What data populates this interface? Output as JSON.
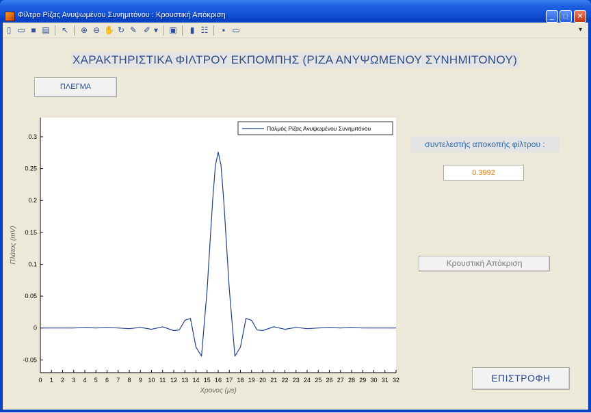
{
  "window": {
    "title": "Φίλτρο Ρίζας Ανυψωμένου Συνημιτόνου : Κρουστική Απόκριση"
  },
  "toolbar": {
    "icons": [
      "new-file-icon",
      "open-folder-icon",
      "save-icon",
      "print-icon",
      "pointer-icon",
      "zoom-in-icon",
      "zoom-out-icon",
      "pan-icon",
      "rotate-3d-icon",
      "data-cursor-icon",
      "brush-icon",
      "dropdown-arrow-icon",
      "link-plot-icon",
      "colorbar-icon",
      "legend-icon",
      "hide-plot-tools-icon",
      "show-plot-tools-icon"
    ]
  },
  "header": {
    "title": "ΧΑΡΑΚΤΗΡΙΣΤΙΚΑ ΦΙΛΤΡΟΥ ΕΚΠΟΜΠΗΣ (ΡΙΖΑ ΑΝΥΨΩΜΕΝΟΥ ΣΥΝΗΜΙΤΟΝΟΥ)"
  },
  "controls": {
    "grid_label": "ΠΛΕΓΜΑ",
    "coef_label": "συντελεστής αποκοπής φίλτρου :",
    "coef_value": "0.3992",
    "impulse_label": "Κρουστική Απόκριση",
    "back_label": "ΕΠΙΣΤΡΟΦΗ"
  },
  "colors": {
    "line": "#1f3f8a",
    "accent_text": "#2a4a86",
    "value_text": "#d77c13"
  },
  "chart_data": {
    "type": "line",
    "title": "",
    "xlabel": "Χρονος (μs)",
    "ylabel": "Πλάτος (mV)",
    "xlim": [
      0,
      32
    ],
    "ylim": [
      -0.07,
      0.33
    ],
    "xticks": [
      0,
      1,
      2,
      3,
      4,
      5,
      6,
      7,
      8,
      9,
      10,
      11,
      12,
      13,
      14,
      15,
      16,
      17,
      18,
      19,
      20,
      21,
      22,
      23,
      24,
      25,
      26,
      27,
      28,
      29,
      30,
      31,
      32
    ],
    "yticks": [
      -0.05,
      0,
      0.05,
      0.1,
      0.15,
      0.2,
      0.25,
      0.3
    ],
    "ytick_labels": [
      "-0.05",
      "0",
      "0.05",
      "0.1",
      "0.15",
      "0.2",
      "0.25",
      "0.3"
    ],
    "grid": false,
    "legend": "top-right",
    "series": [
      {
        "name": "Παλμός Ρίζας Ανυψωμένου Συνημιτόνου",
        "x": [
          0,
          1,
          2,
          3,
          4,
          5,
          6,
          7,
          8,
          9,
          10,
          11,
          12,
          12.5,
          13,
          13.5,
          14,
          14.5,
          15,
          15.25,
          15.5,
          15.75,
          16,
          16.25,
          16.5,
          16.75,
          17,
          17.5,
          18,
          18.5,
          19,
          19.5,
          20,
          21,
          22,
          23,
          24,
          25,
          26,
          27,
          28,
          29,
          30,
          31,
          32
        ],
        "values": [
          0,
          0,
          0,
          0,
          0.001,
          0,
          0.001,
          0,
          -0.001,
          0.001,
          -0.002,
          0.002,
          -0.004,
          -0.003,
          0.012,
          0.015,
          -0.03,
          -0.044,
          0.06,
          0.13,
          0.2,
          0.255,
          0.276,
          0.255,
          0.2,
          0.13,
          0.06,
          -0.044,
          -0.03,
          0.015,
          0.012,
          -0.003,
          -0.004,
          0.002,
          -0.002,
          0.001,
          -0.001,
          0,
          0.001,
          0,
          0.001,
          0,
          0,
          0,
          0
        ]
      }
    ]
  }
}
